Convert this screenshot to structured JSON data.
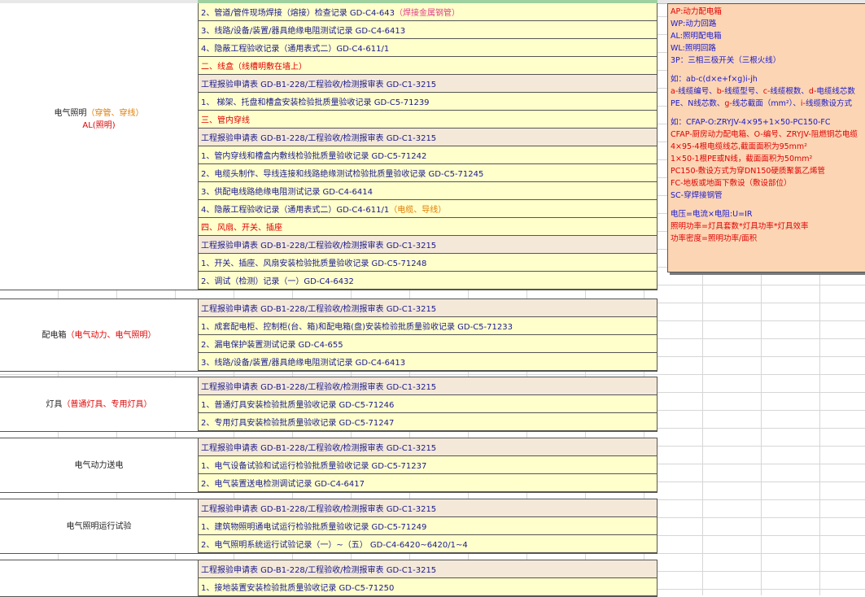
{
  "groups": [
    {
      "label_lines": [
        {
          "parts": [
            {
              "t": "电气照明",
              "c": ""
            },
            {
              "t": "（穿管、穿线）",
              "c": "orange"
            }
          ]
        },
        {
          "parts": [
            {
              "t": "AL(照明)",
              "c": "red"
            }
          ]
        }
      ],
      "rows": [
        {
          "kind": "item",
          "parts": [
            {
              "t": "2、管道/管件现场焊接（熔接）检查记录 GD-C4-643",
              "c": ""
            },
            {
              "t": "（焊接金属钢管）",
              "c": "magenta"
            }
          ]
        },
        {
          "kind": "item",
          "parts": [
            {
              "t": "3、线路/设备/装置/器具绝缘电阻测试记录 GD-C4-6413",
              "c": ""
            }
          ]
        },
        {
          "kind": "item",
          "parts": [
            {
              "t": "4、隐蔽工程验收记录（通用表式二）GD-C4-611/1",
              "c": ""
            }
          ]
        },
        {
          "kind": "sec",
          "parts": [
            {
              "t": "二、线盒（线槽明敷在墙上）",
              "c": ""
            }
          ]
        },
        {
          "kind": "app",
          "parts": [
            {
              "t": "工程报验申请表 GD-B1-228/工程验收/检测报审表 GD-C1-3215",
              "c": ""
            }
          ]
        },
        {
          "kind": "item",
          "parts": [
            {
              "t": "1、 梯架、托盘和槽盒安装检验批质量验收记录 GD-C5-71239",
              "c": ""
            }
          ]
        },
        {
          "kind": "sec",
          "parts": [
            {
              "t": "三、管内穿线",
              "c": ""
            }
          ]
        },
        {
          "kind": "app",
          "parts": [
            {
              "t": "工程报验申请表 GD-B1-228/工程验收/检测报审表 GD-C1-3215",
              "c": ""
            }
          ]
        },
        {
          "kind": "item",
          "parts": [
            {
              "t": "1、管内穿线和槽盒内敷线检验批质量验收记录 GD-C5-71242",
              "c": ""
            }
          ]
        },
        {
          "kind": "item",
          "parts": [
            {
              "t": "2、电缆头制作、导线连接和线路绝缘测试检验批质量验收记录 GD-C5-71245",
              "c": ""
            }
          ]
        },
        {
          "kind": "item",
          "parts": [
            {
              "t": "3、供配电线路绝缘电阻测试记录 GD-C4-6414",
              "c": ""
            }
          ]
        },
        {
          "kind": "item",
          "parts": [
            {
              "t": "4、隐蔽工程验收记录（通用表式二）GD-C4-611/1",
              "c": ""
            },
            {
              "t": "（电缆、导线）",
              "c": "orange"
            }
          ]
        },
        {
          "kind": "sec",
          "parts": [
            {
              "t": "四、风扇、开关、插座",
              "c": ""
            }
          ]
        },
        {
          "kind": "app",
          "parts": [
            {
              "t": "工程报验申请表 GD-B1-228/工程验收/检测报审表 GD-C1-3215",
              "c": ""
            }
          ]
        },
        {
          "kind": "item",
          "parts": [
            {
              "t": "1、开关、插座、风扇安装检验批质量验收记录 GD-C5-71248",
              "c": ""
            }
          ]
        },
        {
          "kind": "item",
          "parts": [
            {
              "t": "2、调试（检测）记录（一）GD-C4-6432",
              "c": ""
            }
          ]
        }
      ]
    },
    {
      "label_lines": [
        {
          "parts": [
            {
              "t": "配电箱",
              "c": ""
            },
            {
              "t": "（电气动力、电气照明）",
              "c": "red"
            }
          ]
        }
      ],
      "rows": [
        {
          "kind": "app",
          "parts": [
            {
              "t": "工程报验申请表 GD-B1-228/工程验收/检测报审表 GD-C1-3215",
              "c": ""
            }
          ]
        },
        {
          "kind": "item",
          "parts": [
            {
              "t": "1、成套配电柜、控制柜(台、箱)和配电箱(盘)安装检验批质量验收记录 GD-C5-71233",
              "c": ""
            }
          ]
        },
        {
          "kind": "item",
          "parts": [
            {
              "t": "2、漏电保护装置测试记录 GD-C4-655",
              "c": ""
            }
          ]
        },
        {
          "kind": "item",
          "parts": [
            {
              "t": "3、线路/设备/装置/器具绝缘电阻测试记录 GD-C4-6413",
              "c": ""
            }
          ]
        }
      ]
    },
    {
      "label_lines": [
        {
          "parts": [
            {
              "t": "灯具",
              "c": ""
            },
            {
              "t": "（普通灯具、专用灯具）",
              "c": "red"
            }
          ]
        }
      ],
      "rows": [
        {
          "kind": "app",
          "parts": [
            {
              "t": "工程报验申请表 GD-B1-228/工程验收/检测报审表 GD-C1-3215",
              "c": ""
            }
          ]
        },
        {
          "kind": "item",
          "parts": [
            {
              "t": "1、普通灯具安装检验批质量验收记录 GD-C5-71246",
              "c": ""
            }
          ]
        },
        {
          "kind": "item",
          "parts": [
            {
              "t": "2、专用灯具安装检验批质量验收记录 GD-C5-71247",
              "c": ""
            }
          ]
        }
      ]
    },
    {
      "label_lines": [
        {
          "parts": [
            {
              "t": "电气动力送电",
              "c": ""
            }
          ]
        }
      ],
      "rows": [
        {
          "kind": "app",
          "parts": [
            {
              "t": "工程报验申请表 GD-B1-228/工程验收/检测报审表 GD-C1-3215",
              "c": ""
            }
          ]
        },
        {
          "kind": "item",
          "parts": [
            {
              "t": "1、电气设备试验和试运行检验批质量验收记录 GD-C5-71237",
              "c": ""
            }
          ]
        },
        {
          "kind": "item",
          "parts": [
            {
              "t": "2、电气装置送电检测调试记录 GD-C4-6417",
              "c": ""
            }
          ]
        }
      ]
    },
    {
      "label_lines": [
        {
          "parts": [
            {
              "t": "电气照明运行试验",
              "c": ""
            }
          ]
        }
      ],
      "rows": [
        {
          "kind": "app",
          "parts": [
            {
              "t": "工程报验申请表 GD-B1-228/工程验收/检测报审表 GD-C1-3215",
              "c": ""
            }
          ]
        },
        {
          "kind": "item",
          "parts": [
            {
              "t": "1、建筑物照明通电试运行检验批质量验收记录 GD-C5-71249",
              "c": ""
            }
          ]
        },
        {
          "kind": "item",
          "parts": [
            {
              "t": "2、电气照明系统运行试验记录（一）~（五） GD-C4-6420~6420/1~4",
              "c": ""
            }
          ]
        }
      ]
    },
    {
      "label_lines": [],
      "rows": [
        {
          "kind": "app",
          "parts": [
            {
              "t": "工程报验申请表 GD-B1-228/工程验收/检测报审表 GD-C1-3215",
              "c": ""
            }
          ]
        },
        {
          "kind": "item",
          "parts": [
            {
              "t": "1、接地装置安装检验批质量验收记录 GD-C5-71250",
              "c": ""
            }
          ]
        }
      ]
    }
  ],
  "note": {
    "lines": [
      {
        "parts": [
          {
            "t": "AP:动力配电箱",
            "c": "red"
          }
        ]
      },
      {
        "parts": [
          {
            "t": "WP:动力回路",
            "c": "blue"
          }
        ]
      },
      {
        "parts": [
          {
            "t": "AL:照明配电箱",
            "c": "blue"
          }
        ]
      },
      {
        "parts": [
          {
            "t": "WL:照明回路",
            "c": "blue"
          }
        ]
      },
      {
        "parts": [
          {
            "t": "3P：三相三极开关（三根火线）",
            "c": "blue"
          }
        ]
      },
      {
        "gap": true
      },
      {
        "parts": [
          {
            "t": "如：ab-c(d×e+f×g)i-jh",
            "c": "blue"
          }
        ]
      },
      {
        "parts": [
          {
            "t": "a-",
            "c": "red"
          },
          {
            "t": "线缆编号、",
            "c": "blue"
          },
          {
            "t": "b-",
            "c": "red"
          },
          {
            "t": "线缆型号、",
            "c": "blue"
          },
          {
            "t": "c-",
            "c": "red"
          },
          {
            "t": "线缆根数、",
            "c": "blue"
          },
          {
            "t": "d-",
            "c": "red"
          },
          {
            "t": "电缆线芯数",
            "c": "blue"
          }
        ]
      },
      {
        "parts": [
          {
            "t": "PE、N线芯数、",
            "c": "blue"
          },
          {
            "t": "g-",
            "c": "red"
          },
          {
            "t": "线芯截面（mm²）、",
            "c": "blue"
          },
          {
            "t": "i-",
            "c": "red"
          },
          {
            "t": "线缆敷设方式",
            "c": "blue"
          }
        ]
      },
      {
        "gap": true
      },
      {
        "parts": [
          {
            "t": "如：CFAP-O:ZRYJV-4×95+1×50-PC150-FC",
            "c": "blue"
          }
        ]
      },
      {
        "parts": [
          {
            "t": "CFAP-厨房动力配电箱、O-编号、ZRYJV-阻燃铜芯电缆",
            "c": "red"
          }
        ]
      },
      {
        "parts": [
          {
            "t": "4×95-4根电缆线芯,截面面积为95mm²",
            "c": "red"
          }
        ]
      },
      {
        "parts": [
          {
            "t": "1×50-1根PE或N线，截面面积为50mm²",
            "c": "red"
          }
        ]
      },
      {
        "parts": [
          {
            "t": "PC150-敷设方式为穿DN150硬质聚氯乙烯管",
            "c": "red"
          }
        ]
      },
      {
        "parts": [
          {
            "t": "FC-地板或地面下敷设（敷设部位）",
            "c": "red"
          }
        ]
      },
      {
        "parts": [
          {
            "t": "SC-穿焊接钢管",
            "c": "blue"
          }
        ]
      },
      {
        "gap": true
      },
      {
        "parts": [
          {
            "t": "电压=电流×电阻:U=IR",
            "c": "blue"
          }
        ]
      },
      {
        "parts": [
          {
            "t": "照明功率=灯具套数*灯具功率*灯具效率",
            "c": "red"
          }
        ]
      },
      {
        "parts": [
          {
            "t": "功率密度=照明功率/面积",
            "c": "red"
          }
        ]
      }
    ]
  }
}
